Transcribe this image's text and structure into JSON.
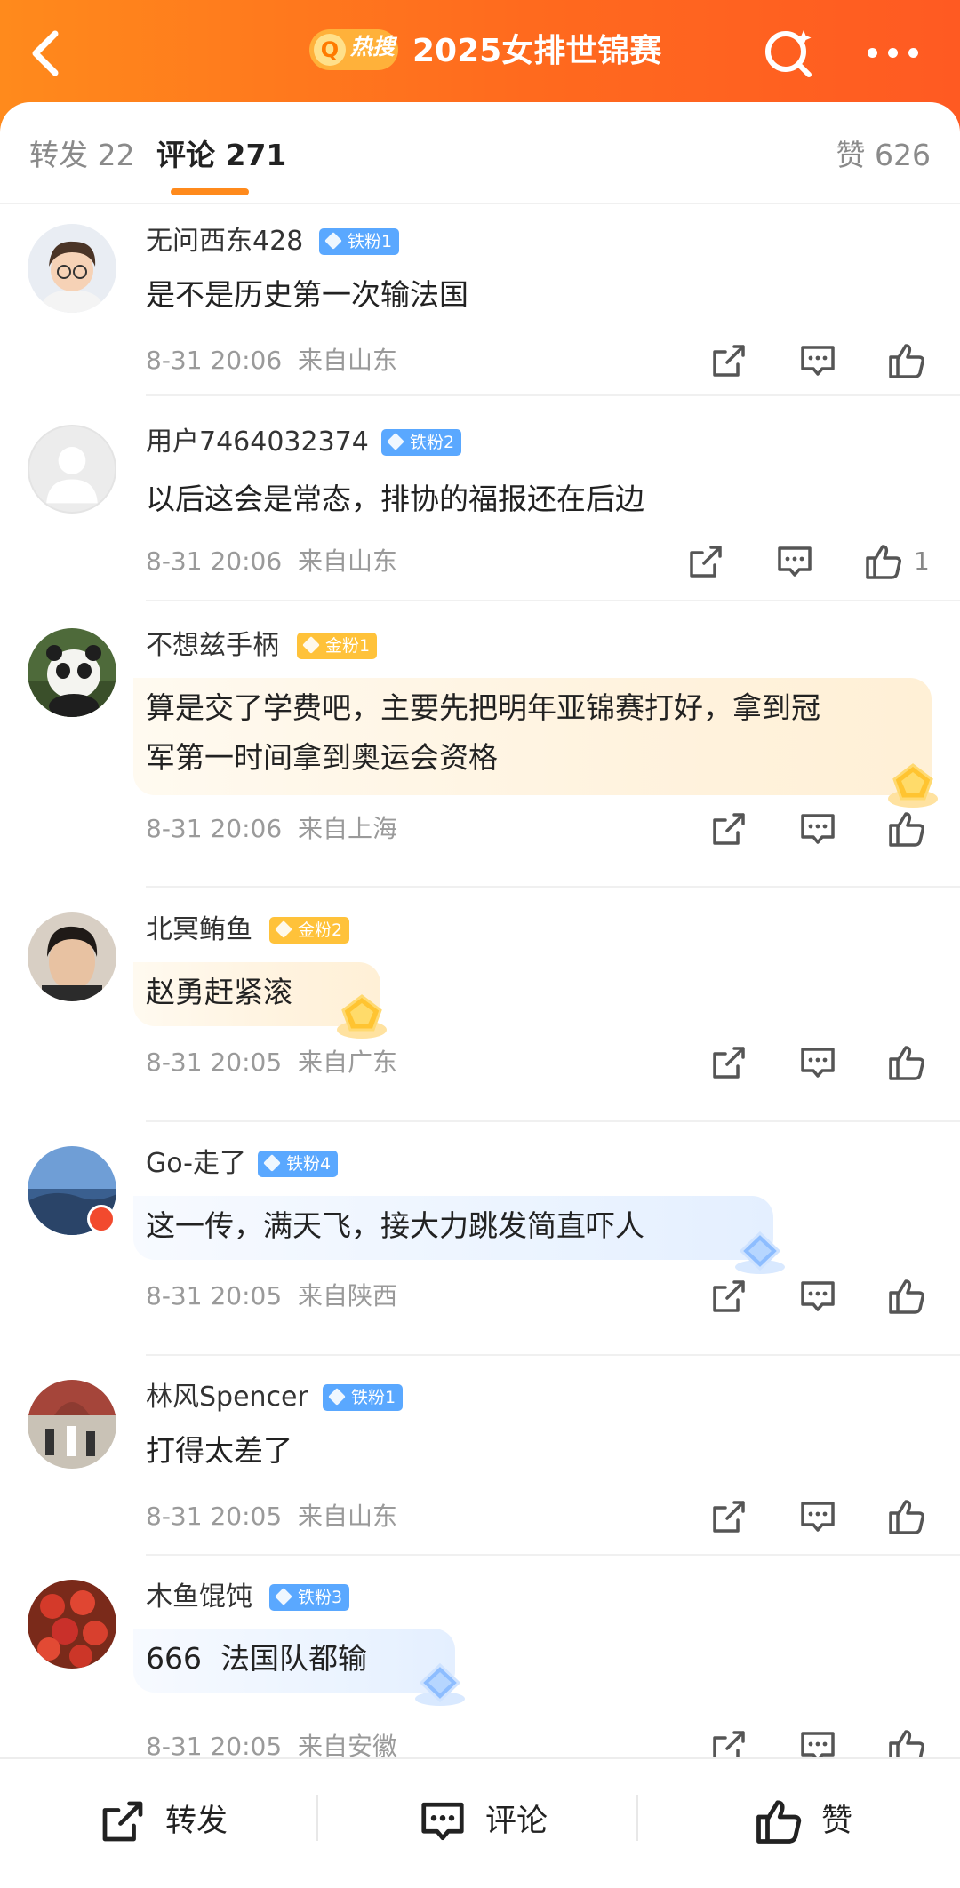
{
  "header": {
    "hot_badge": "热搜",
    "title": "2025女排世锦赛"
  },
  "tabs": {
    "repost": "转发 22",
    "comment": "评论 271",
    "like": "赞 626"
  },
  "comments": [
    {
      "name": "无问西东428",
      "badge": "铁粉1",
      "text": "是不是历史第一次输法国",
      "time": "8-31 20:06",
      "location": "来自山东",
      "likes": ""
    },
    {
      "name": "用户7464032374",
      "badge": "铁粉2",
      "text": "以后这会是常态，排协的福报还在后边",
      "time": "8-31 20:06",
      "location": "来自山东",
      "likes": "1"
    },
    {
      "name": "不想兹手柄",
      "badge": "金粉1",
      "text_line1": "算是交了学费吧，主要先把明年亚锦赛打好，拿到冠",
      "text_line2": "军第一时间拿到奥运会资格",
      "time": "8-31 20:06",
      "location": "来自上海",
      "likes": ""
    },
    {
      "name": "北冥鲔鱼",
      "badge": "金粉2",
      "text": "赵勇赶紧滚",
      "time": "8-31 20:05",
      "location": "来自广东",
      "likes": ""
    },
    {
      "name": "Go-走了",
      "badge": "铁粉4",
      "text": "这一传，满天飞，接大力跳发简直吓人",
      "time": "8-31 20:05",
      "location": "来自陕西",
      "likes": ""
    },
    {
      "name": "林风Spencer",
      "badge": "铁粉1",
      "text": "打得太差了",
      "time": "8-31 20:05",
      "location": "来自山东",
      "likes": ""
    },
    {
      "name": "木鱼馄饨",
      "badge": "铁粉3",
      "text": "666  法国队都输",
      "time": "8-31 20:05",
      "location": "来自安徽",
      "likes": ""
    }
  ],
  "bottom_bar": {
    "repost": "转发",
    "comment": "评论",
    "like": "赞"
  },
  "colors": {
    "header_orange": "#ff7a1e",
    "tab_underline": "#ff8a1c",
    "iron_badge": "#5aa8ff",
    "gold_badge": "#ffc23a"
  },
  "icons": [
    "back-arrow-icon",
    "search-icon",
    "more-dots-icon",
    "share-icon",
    "comment-icon",
    "like-icon"
  ]
}
